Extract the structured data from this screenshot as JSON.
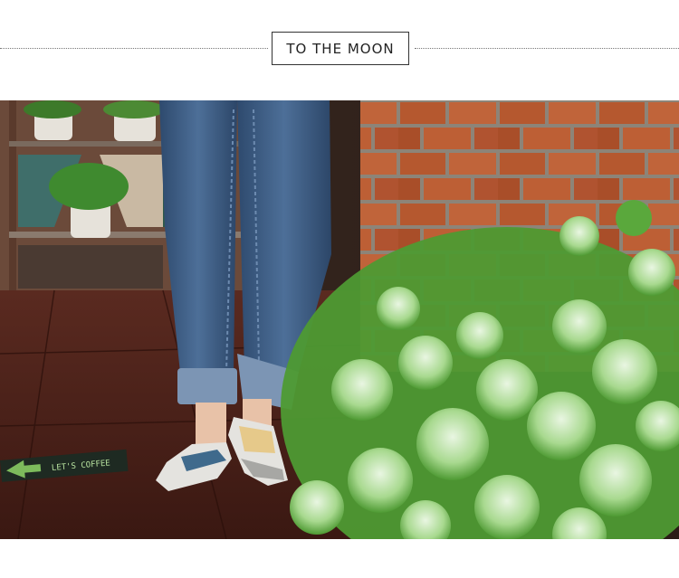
{
  "banner": {
    "title": "TO THE MOON"
  },
  "photo": {
    "subject": "jeans-and-no-show-socks",
    "floor_sign_text": "LET'S COFFEE"
  },
  "colors": {
    "brick": "#b5582f",
    "mortar": "#8d8478",
    "denim": "#3f5f86",
    "floor": "#4a2019",
    "foliage": "#6dbb4a"
  }
}
